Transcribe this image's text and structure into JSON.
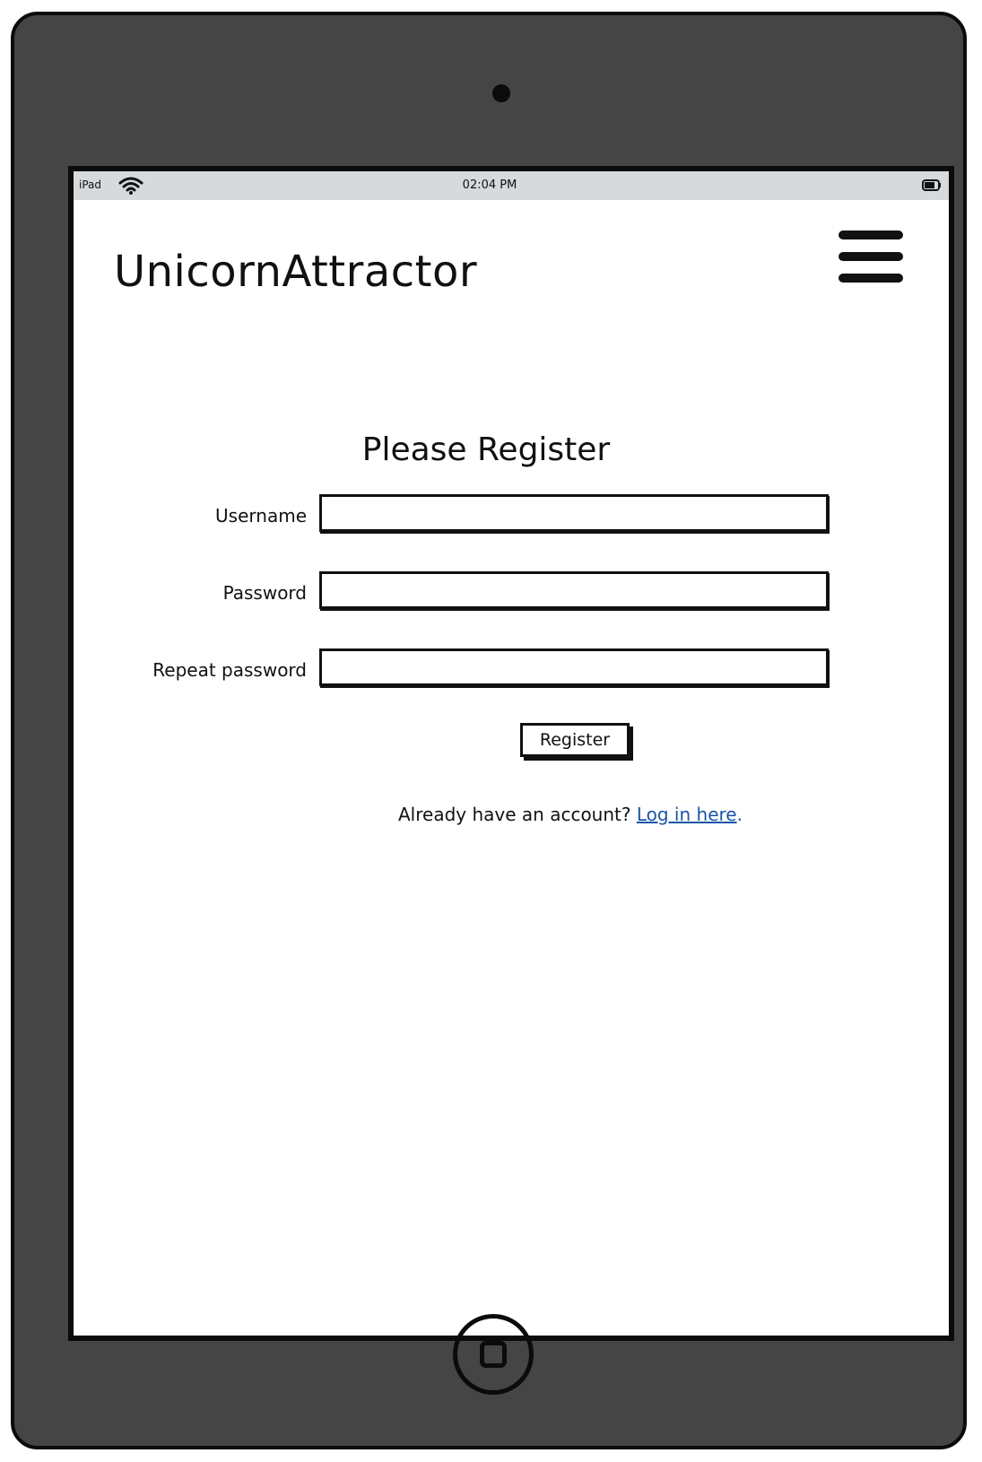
{
  "status_bar": {
    "device": "iPad",
    "time": "02:04 PM",
    "icons": [
      "wifi-icon",
      "battery-icon"
    ]
  },
  "header": {
    "app_title": "UnicornAttractor",
    "menu_icon": "hamburger-menu-icon"
  },
  "form": {
    "title": "Please Register",
    "fields": [
      {
        "label": "Username",
        "value": "",
        "placeholder": ""
      },
      {
        "label": "Password",
        "value": "",
        "placeholder": ""
      },
      {
        "label": "Repeat password",
        "value": "",
        "placeholder": ""
      }
    ],
    "submit_label": "Register",
    "login_prompt": "Already have an account?",
    "login_link": "Log in here",
    "login_suffix": "."
  },
  "colors": {
    "device_body": "#454545",
    "status_bar": "#d6dadd",
    "link": "#1a56a6"
  }
}
